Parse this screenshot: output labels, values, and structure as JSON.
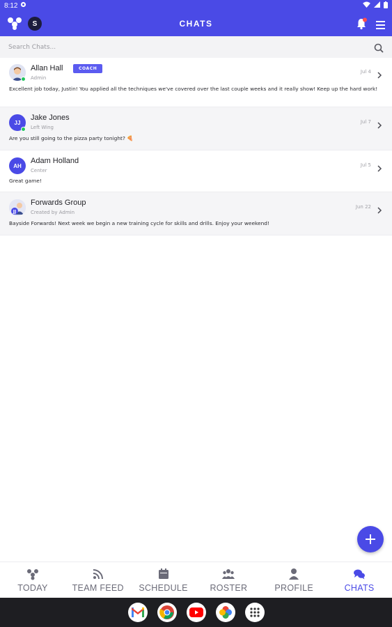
{
  "status_bar": {
    "time": "8:12"
  },
  "app_bar": {
    "title": "CHATS",
    "team_initial": "S"
  },
  "search": {
    "placeholder": "Search Chats..."
  },
  "chats": [
    {
      "name": "Allan Hall",
      "badge": "COACH",
      "subtitle": "Admin",
      "date": "Jul 4",
      "message": "Excellent job today, Justin! You applied all the techniques we've covered over the last couple weeks and it really show! Keep up the hard work!"
    },
    {
      "name": "Jake Jones",
      "initials": "JJ",
      "subtitle": "Left Wing",
      "date": "Jul 7",
      "message": "Are you still going to the pizza party tonight? 🍕"
    },
    {
      "name": "Adam Holland",
      "initials": "AH",
      "subtitle": "Center",
      "date": "Jul 5",
      "message": "Great game!"
    },
    {
      "name": "Forwards Group",
      "subtitle": "Created by Admin",
      "date": "Jun 22",
      "message": "Bayside Forwards! Next week we begin a new training cycle for skills and drills. Enjoy your weekend!"
    }
  ],
  "bottom_nav": [
    {
      "label": "TODAY",
      "icon": "today-icon"
    },
    {
      "label": "TEAM FEED",
      "icon": "feed-icon"
    },
    {
      "label": "SCHEDULE",
      "icon": "calendar-icon"
    },
    {
      "label": "ROSTER",
      "icon": "roster-icon"
    },
    {
      "label": "PROFILE",
      "icon": "profile-icon"
    },
    {
      "label": "CHATS",
      "icon": "chats-icon",
      "active": true
    }
  ],
  "colors": {
    "primary": "#4a4ae6",
    "online": "#22c55e",
    "badge": "#5b5bf0"
  }
}
